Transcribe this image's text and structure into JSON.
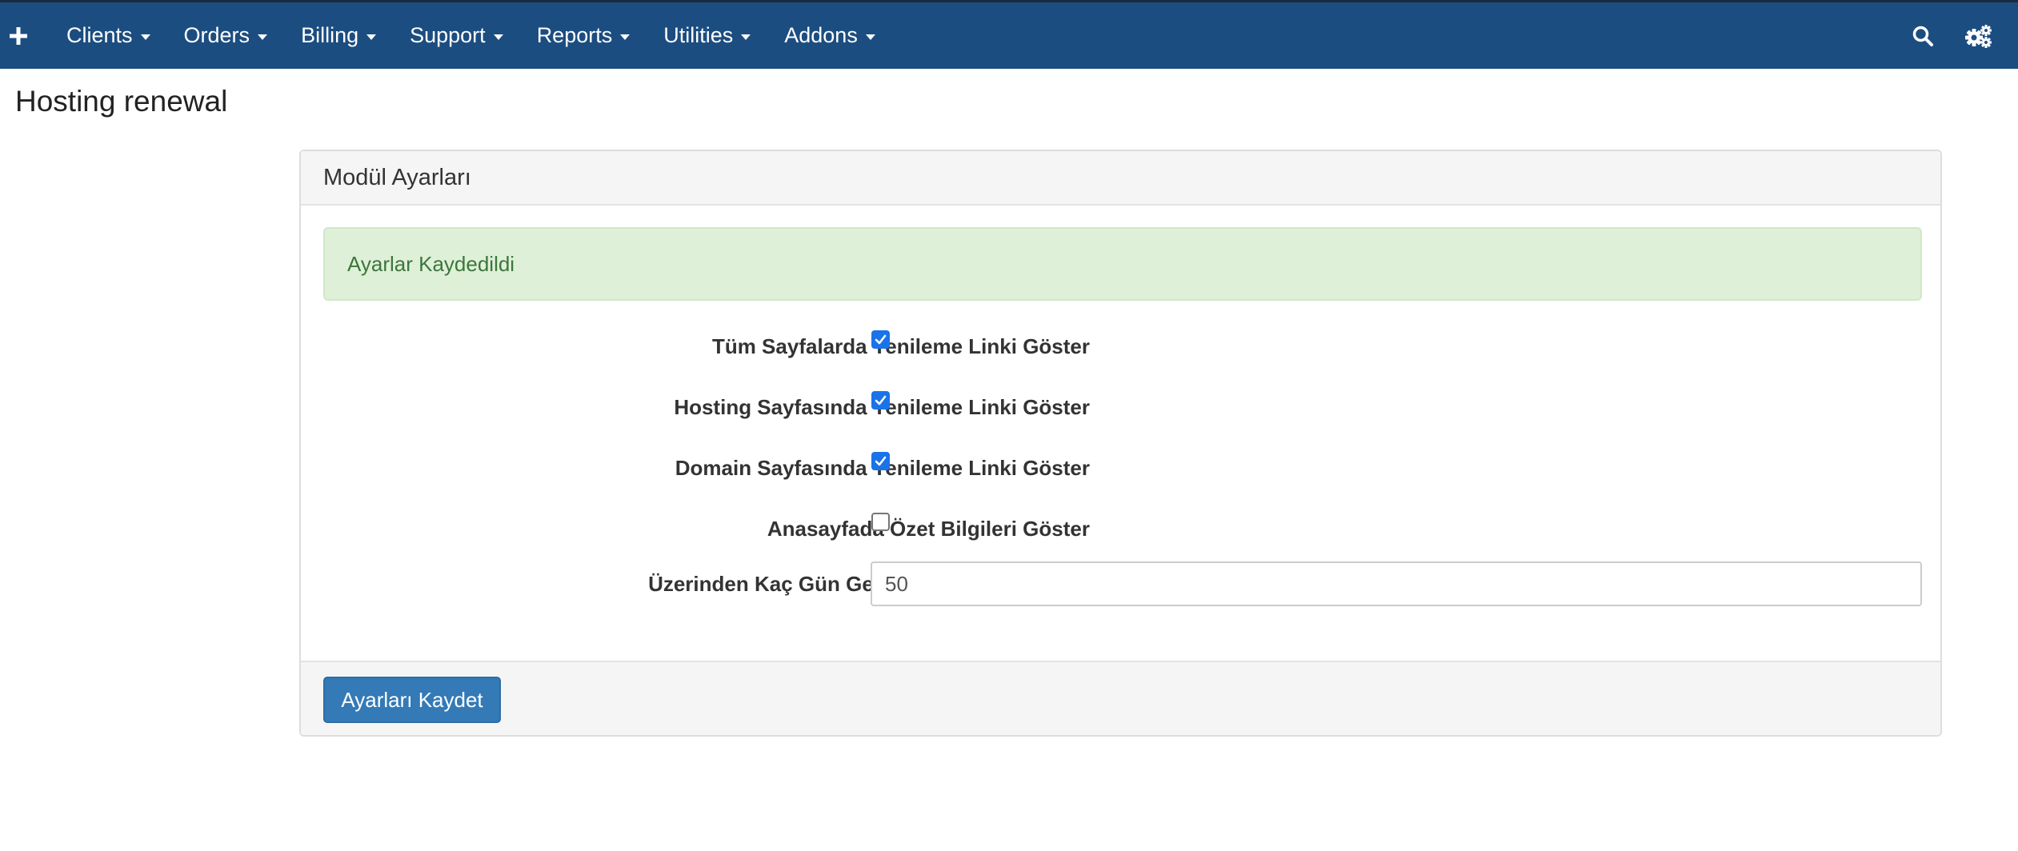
{
  "navbar": {
    "add_icon": "plus-icon",
    "menu": [
      {
        "label": "Clients"
      },
      {
        "label": "Orders"
      },
      {
        "label": "Billing"
      },
      {
        "label": "Support"
      },
      {
        "label": "Reports"
      },
      {
        "label": "Utilities"
      },
      {
        "label": "Addons"
      }
    ],
    "search_icon": "search-icon",
    "setup_icon": "gears-icon",
    "bg_color": "#1c4d80"
  },
  "page": {
    "title": "Hosting renewal"
  },
  "panel": {
    "heading": "Modül Ayarları",
    "alert": "Ayarlar Kaydedildi",
    "fields": [
      {
        "label": "Tüm Sayfalarda Yenileme Linki Göster",
        "type": "checkbox",
        "checked": true
      },
      {
        "label": "Hosting Sayfasında Yenileme Linki Göster",
        "type": "checkbox",
        "checked": true
      },
      {
        "label": "Domain Sayfasında Yenileme Linki Göster",
        "type": "checkbox",
        "checked": true
      },
      {
        "label": "Anasayfada Özet Bilgileri Göster",
        "type": "checkbox",
        "checked": false
      },
      {
        "label": "Üzerinden Kaç Gün Geçmiş Domainleri Gizle",
        "type": "text",
        "value": "50"
      }
    ],
    "save_button": "Ayarları Kaydet"
  },
  "colors": {
    "accent": "#337ab7",
    "alert_bg": "#dff0d8",
    "alert_text": "#3c763d",
    "checkbox": "#1a73e8"
  }
}
